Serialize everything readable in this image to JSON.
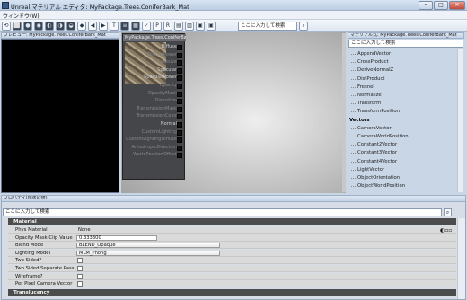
{
  "window": {
    "title": "Unreal マテリアル エディタ: MyPackage.Trees.ConiferBark_Mat",
    "minimize": "–",
    "maximize": "□",
    "close": "✕"
  },
  "menu": {
    "window": "ウィンドウ(W)"
  },
  "toolbar": {
    "search_placeholder": "ここに入力して検索",
    "buttons": [
      "⟲",
      "⬜",
      "●",
      "◉",
      "◐",
      "◑",
      "◒",
      "◆",
      "◀",
      "▶",
      "T",
      "≡",
      "▦",
      "✓",
      "P",
      "R",
      "▤",
      "▥",
      "▣",
      "▣"
    ]
  },
  "preview": {
    "header": "プレビュー: MyPackage.Trees.ConiferBark_Mat"
  },
  "node": {
    "title": "MyPackage.Trees.ConiferBark_Mat",
    "pins": [
      {
        "label": "Diffuse",
        "active": true
      },
      {
        "label": "DiffusePower",
        "active": false
      },
      {
        "label": "Emissive",
        "active": false
      },
      {
        "label": "Specular",
        "active": true
      },
      {
        "label": "SpecularPower",
        "active": true
      },
      {
        "label": "Opacity",
        "active": false
      },
      {
        "label": "OpacityMask",
        "active": false
      },
      {
        "label": "Distortion",
        "active": false
      },
      {
        "label": "TransmissionMask",
        "active": false
      },
      {
        "label": "TransmissionColor",
        "active": false
      },
      {
        "label": "Normal",
        "active": true
      },
      {
        "label": "CustomLighting",
        "active": false
      },
      {
        "label": "CustomLightingDiffuse",
        "active": false
      },
      {
        "label": "AnisotropicDirection",
        "active": false
      },
      {
        "label": "WorldPositionOffset",
        "active": false
      }
    ]
  },
  "library": {
    "header": "マテリアル式: MyPackage.Trees.ConiferBark_Mat",
    "search_placeholder": "ここに入力して検索",
    "items": [
      {
        "label": "AppendVector",
        "category": false
      },
      {
        "label": "CrossProduct",
        "category": false
      },
      {
        "label": "DeriveNormalZ",
        "category": false
      },
      {
        "label": "DistProduct",
        "category": false
      },
      {
        "label": "Fresnel",
        "category": false
      },
      {
        "label": "Normalize",
        "category": false
      },
      {
        "label": "Transform",
        "category": false
      },
      {
        "label": "TransformPosition",
        "category": false
      },
      {
        "label": "Vectors",
        "category": true
      },
      {
        "label": "CameraVector",
        "category": false
      },
      {
        "label": "CameraWorldPosition",
        "category": false
      },
      {
        "label": "Constant2Vector",
        "category": false
      },
      {
        "label": "Constant3Vector",
        "category": false
      },
      {
        "label": "Constant4Vector",
        "category": false
      },
      {
        "label": "LightVector",
        "category": false
      },
      {
        "label": "ObjectOrientation",
        "category": false
      },
      {
        "label": "ObjectWorldPosition",
        "category": false
      }
    ]
  },
  "properties": {
    "header": "プロパティ(現状の値)",
    "search_placeholder": "ここに入力して検索",
    "category_material": "Material",
    "category_translucency": "Translucency",
    "rows": [
      {
        "label": "Phys Material",
        "value": "None",
        "kind": "text"
      },
      {
        "label": "Opacity Mask Clip Value",
        "value": "0.333300",
        "kind": "box"
      },
      {
        "label": "Blend Mode",
        "value": "BLEND_Opaque",
        "kind": "combo"
      },
      {
        "label": "Lighting Model",
        "value": "MLM_Phong",
        "kind": "combo"
      },
      {
        "label": "Two Sided?",
        "value": "",
        "kind": "check"
      },
      {
        "label": "Two Sided Separate Pass",
        "value": "",
        "kind": "check"
      },
      {
        "label": "Wireframe?",
        "value": "",
        "kind": "check"
      },
      {
        "label": "Per Pixel Camera Vector",
        "value": "",
        "kind": "check"
      }
    ]
  }
}
